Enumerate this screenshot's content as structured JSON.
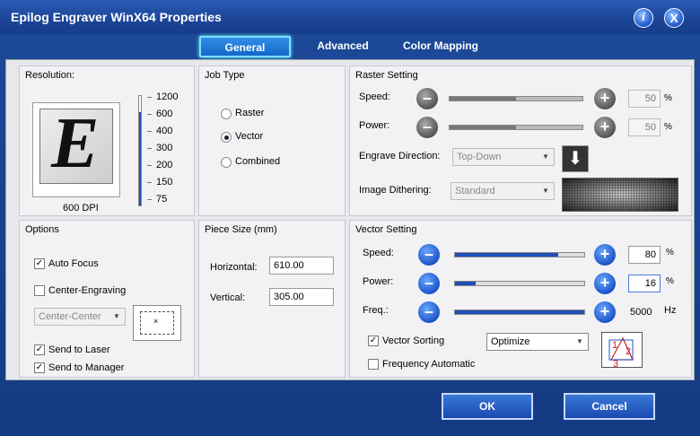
{
  "window": {
    "title": "Epilog Engraver WinX64 Properties",
    "info_glyph": "i",
    "close_glyph": "X"
  },
  "tabs": [
    {
      "label": "General",
      "active": true
    },
    {
      "label": "Advanced"
    },
    {
      "label": "Color Mapping"
    }
  ],
  "resolution": {
    "title": "Resolution:",
    "preview_letter": "E",
    "current": "600 DPI",
    "scale": [
      "1200",
      "600",
      "400",
      "300",
      "200",
      "150",
      "75"
    ],
    "slider_fraction": 0.85
  },
  "job_type": {
    "title": "Job Type",
    "options": [
      "Raster",
      "Vector",
      "Combined"
    ],
    "selected": "Vector"
  },
  "raster": {
    "title": "Raster Setting",
    "speed_label": "Speed:",
    "speed_value": "50",
    "speed_unit": "%",
    "power_label": "Power:",
    "power_value": "50",
    "power_unit": "%",
    "direction_label": "Engrave Direction:",
    "direction_value": "Top-Down",
    "dithering_label": "Image Dithering:",
    "dithering_value": "Standard"
  },
  "options": {
    "title": "Options",
    "auto_focus": "Auto Focus",
    "auto_focus_checked": true,
    "center_engraving": "Center-Engraving",
    "center_engraving_checked": false,
    "center_select": "Center-Center",
    "send_laser": "Send to Laser",
    "send_laser_checked": true,
    "send_manager": "Send to Manager",
    "send_manager_checked": true,
    "check_glyph": "✓"
  },
  "piece": {
    "title": "Piece Size (mm)",
    "horizontal_label": "Horizontal:",
    "horizontal_value": "610.00",
    "vertical_label": "Vertical:",
    "vertical_value": "305.00"
  },
  "vector": {
    "title": "Vector Setting",
    "speed_label": "Speed:",
    "speed_value": "80",
    "speed_unit": "%",
    "speed_fraction": 0.8,
    "power_label": "Power:",
    "power_value": "16",
    "power_unit": "%",
    "power_fraction": 0.16,
    "freq_label": "Freq.:",
    "freq_value": "5000",
    "freq_unit": "Hz",
    "freq_fraction": 1.0,
    "sorting_label": "Vector Sorting",
    "sorting_checked": true,
    "sorting_value": "Optimize",
    "freq_auto_label": "Frequency Automatic",
    "freq_auto_checked": false,
    "order_digits": [
      "1",
      "2",
      "3"
    ]
  },
  "buttons": {
    "ok": "OK",
    "cancel": "Cancel"
  }
}
